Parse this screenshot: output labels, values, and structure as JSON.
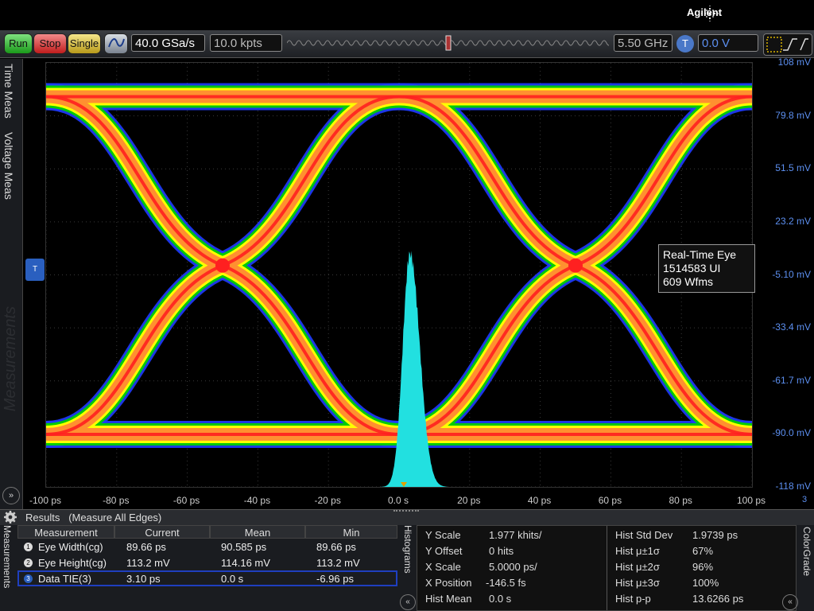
{
  "header": {
    "brand": "Agilent"
  },
  "toolbar": {
    "run_label": "Run",
    "stop_label": "Stop",
    "single_label": "Single",
    "sample_rate": "40.0 GSa/s",
    "memory_depth": "10.0 kpts",
    "bandwidth": "5.50 GHz",
    "trigger_badge": "T",
    "trigger_level": "0.0 V"
  },
  "left_tabs": {
    "time_meas": "Time Meas",
    "voltage_meas": "Voltage Meas",
    "measurements_ghost": "Measurements"
  },
  "side_indicator": "T",
  "chart_data": {
    "type": "heatmap",
    "title": "",
    "xlabel": "",
    "ylabel": "",
    "x_ticks": [
      "-100 ps",
      "-80 ps",
      "-60 ps",
      "-40 ps",
      "-20 ps",
      "0.0 s",
      "20 ps",
      "40 ps",
      "60 ps",
      "80 ps",
      "100 ps"
    ],
    "y_ticks": [
      "108 mV",
      "79.8 mV",
      "51.5 mV",
      "23.2 mV",
      "-5.10 mV",
      "-33.4 mV",
      "-61.7 mV",
      "-90.0 mV",
      "-118 mV"
    ],
    "xlim": [
      -100,
      100
    ],
    "ylim": [
      -118,
      108
    ],
    "x_unit": "ps",
    "y_unit": "mV",
    "eye_levels_mv": [
      90,
      -90
    ],
    "crossings_ps": [
      -50,
      50
    ],
    "eye_color_scale": [
      "#1f3cff",
      "#00d000",
      "#ffff00",
      "#ff9030",
      "#ff2020"
    ],
    "histogram": {
      "color": "#22e0e0",
      "center_ps": 3.1,
      "peak_fraction": 0.55
    },
    "channel_number": "3"
  },
  "info_box": {
    "line1": "Real-Time Eye",
    "line2": "1514583 UI",
    "line3": "609 Wfms"
  },
  "results": {
    "title": "Results",
    "mode": "(Measure All Edges)"
  },
  "measurements_tab": "Measurements",
  "table": {
    "headers": [
      "Measurement",
      "Current",
      "Mean",
      "Min"
    ],
    "rows": [
      {
        "num": "1",
        "name": "Eye Width(cg)",
        "current": "89.66 ps",
        "mean": "90.585 ps",
        "min": "89.66 ps"
      },
      {
        "num": "2",
        "name": "Eye Height(cg)",
        "current": "113.2 mV",
        "mean": "114.16 mV",
        "min": "113.2 mV"
      },
      {
        "num": "3",
        "name": "Data TIE(3)",
        "current": "3.10 ps",
        "mean": "0.0 s",
        "min": "-6.96 ps"
      }
    ]
  },
  "histogram_tab": "Histograms",
  "histogram_stats": {
    "left": [
      {
        "label": "Y Scale",
        "value": "1.977 khits/"
      },
      {
        "label": "Y Offset",
        "value": "0 hits"
      },
      {
        "label": "X Scale",
        "value": "5.0000 ps/"
      },
      {
        "label": "X Position",
        "value": "-146.5 fs"
      },
      {
        "label": "Hist Mean",
        "value": "0.0 s"
      }
    ],
    "right": [
      {
        "label": "Hist Std Dev",
        "value": "1.9739 ps"
      },
      {
        "label": "Hist μ±1σ",
        "value": "67%"
      },
      {
        "label": "Hist μ±2σ",
        "value": "96%"
      },
      {
        "label": "Hist μ±3σ",
        "value": "100%"
      },
      {
        "label": "Hist p-p",
        "value": "13.6266 ps"
      }
    ]
  },
  "colorgrade_tab": "ColorGrade",
  "colors": {
    "accent_blue": "#5c8ff0",
    "run_green": "#1a9a1a",
    "stop_red": "#c01d1d",
    "single_yellow": "#b89a1a"
  }
}
